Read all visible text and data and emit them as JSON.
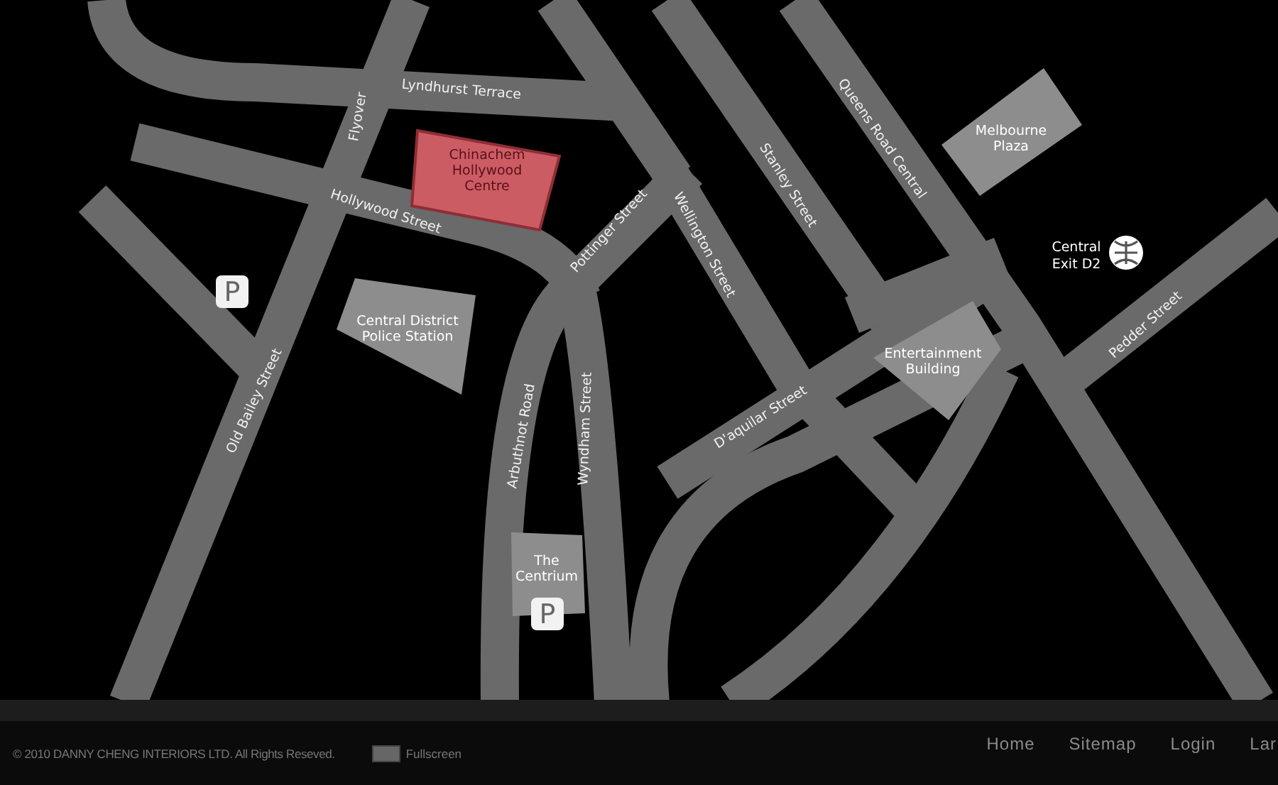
{
  "map": {
    "streets": [
      {
        "name": "Lyndhurst Terrace"
      },
      {
        "name": "Flyover"
      },
      {
        "name": "Hollywood Street"
      },
      {
        "name": "Pottinger Street"
      },
      {
        "name": "Wellington Street"
      },
      {
        "name": "Stanley Street"
      },
      {
        "name": "Queens Road Central"
      },
      {
        "name": "Old Bailey Street"
      },
      {
        "name": "Arbuthnot Road"
      },
      {
        "name": "Wyndham Street"
      },
      {
        "name": "D'aquilar Street"
      },
      {
        "name": "Pedder Street"
      }
    ],
    "buildings": [
      {
        "lines": [
          "Chinachem",
          "Hollywood",
          "Centre"
        ],
        "highlighted": true
      },
      {
        "lines": [
          "Central District",
          "Police Station"
        ],
        "highlighted": false
      },
      {
        "lines": [
          "Melbourne",
          "Plaza"
        ],
        "highlighted": false
      },
      {
        "lines": [
          "Entertainment",
          "Building"
        ],
        "highlighted": false
      },
      {
        "lines": [
          "The",
          "Centrium"
        ],
        "highlighted": false
      }
    ],
    "station": {
      "lines": [
        "Central",
        "Exit D2"
      ]
    },
    "parking": [
      {
        "label": "P"
      },
      {
        "label": "P"
      }
    ]
  },
  "footer": {
    "copyright": "© 2010 DANNY CHENG INTERIORS LTD. All Rights Reseved.",
    "fullscreen": "Fullscreen",
    "links": [
      {
        "label": "Home"
      },
      {
        "label": "Sitemap"
      },
      {
        "label": "Login"
      },
      {
        "label": "Lar"
      }
    ]
  }
}
